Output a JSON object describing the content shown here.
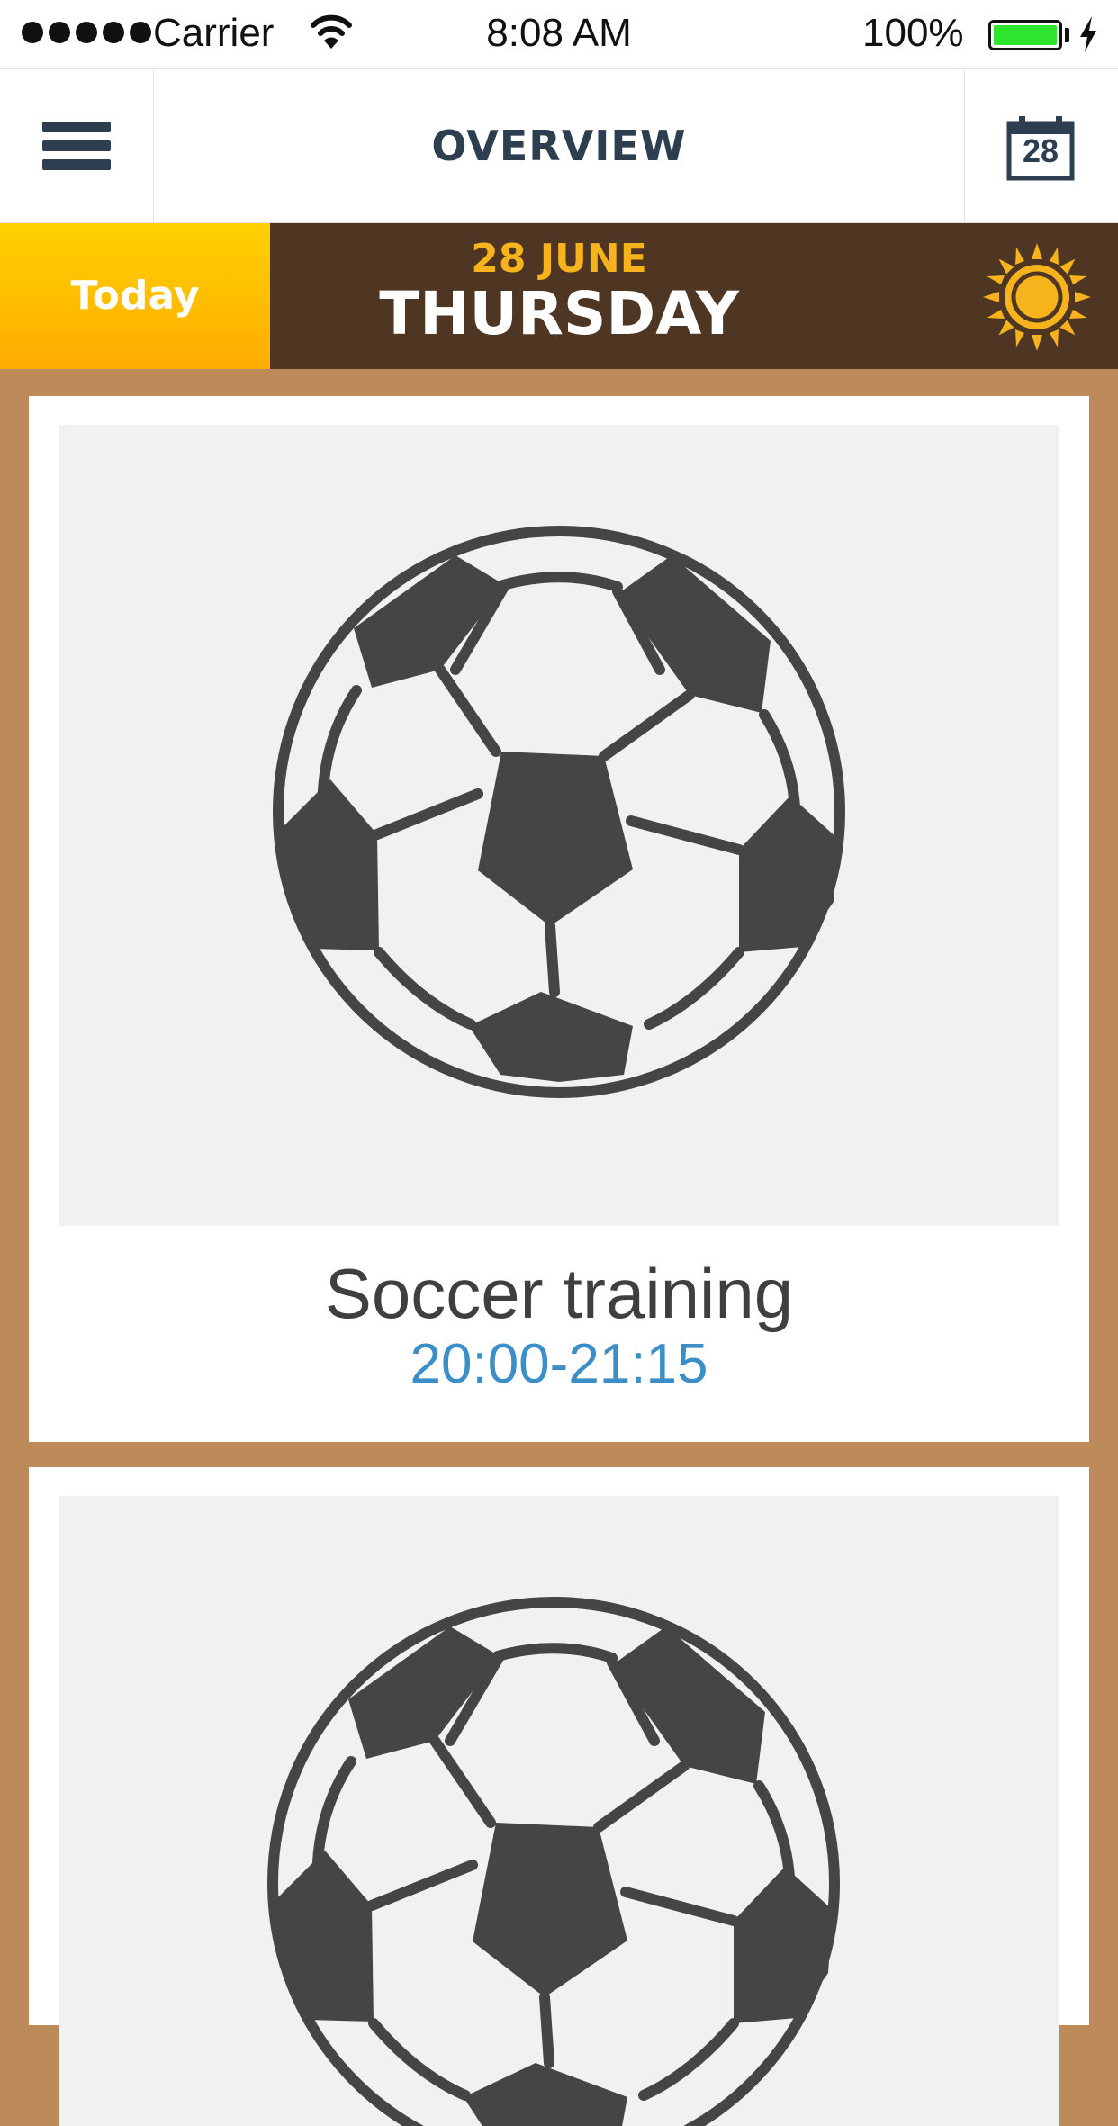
{
  "status_bar": {
    "carrier": "Carrier",
    "time": "8:08 AM",
    "battery_percent": "100%",
    "battery_level": 1.0,
    "battery_color": "#2ee52e",
    "signal_icon": "signal-dots-icon",
    "wifi_icon": "wifi-icon",
    "charging_icon": "lightning-bolt-icon"
  },
  "nav": {
    "menu_icon": "hamburger-menu-icon",
    "title": "OVERVIEW",
    "calendar_icon": "calendar-icon",
    "calendar_day": "28"
  },
  "date_banner": {
    "today_label": "Today",
    "date": "28 JUNE",
    "weekday": "THURSDAY",
    "weather_icon": "sun-icon",
    "accent_color": "#f7b31c",
    "background_color": "#4e3622"
  },
  "events": [
    {
      "icon": "soccer-ball-icon",
      "title": "Soccer training",
      "time": "20:00-21:15"
    },
    {
      "icon": "soccer-ball-icon"
    }
  ],
  "colors": {
    "page_background": "#bd8a5a",
    "primary_text": "#2d3e50",
    "time_text": "#3c8ec7"
  }
}
